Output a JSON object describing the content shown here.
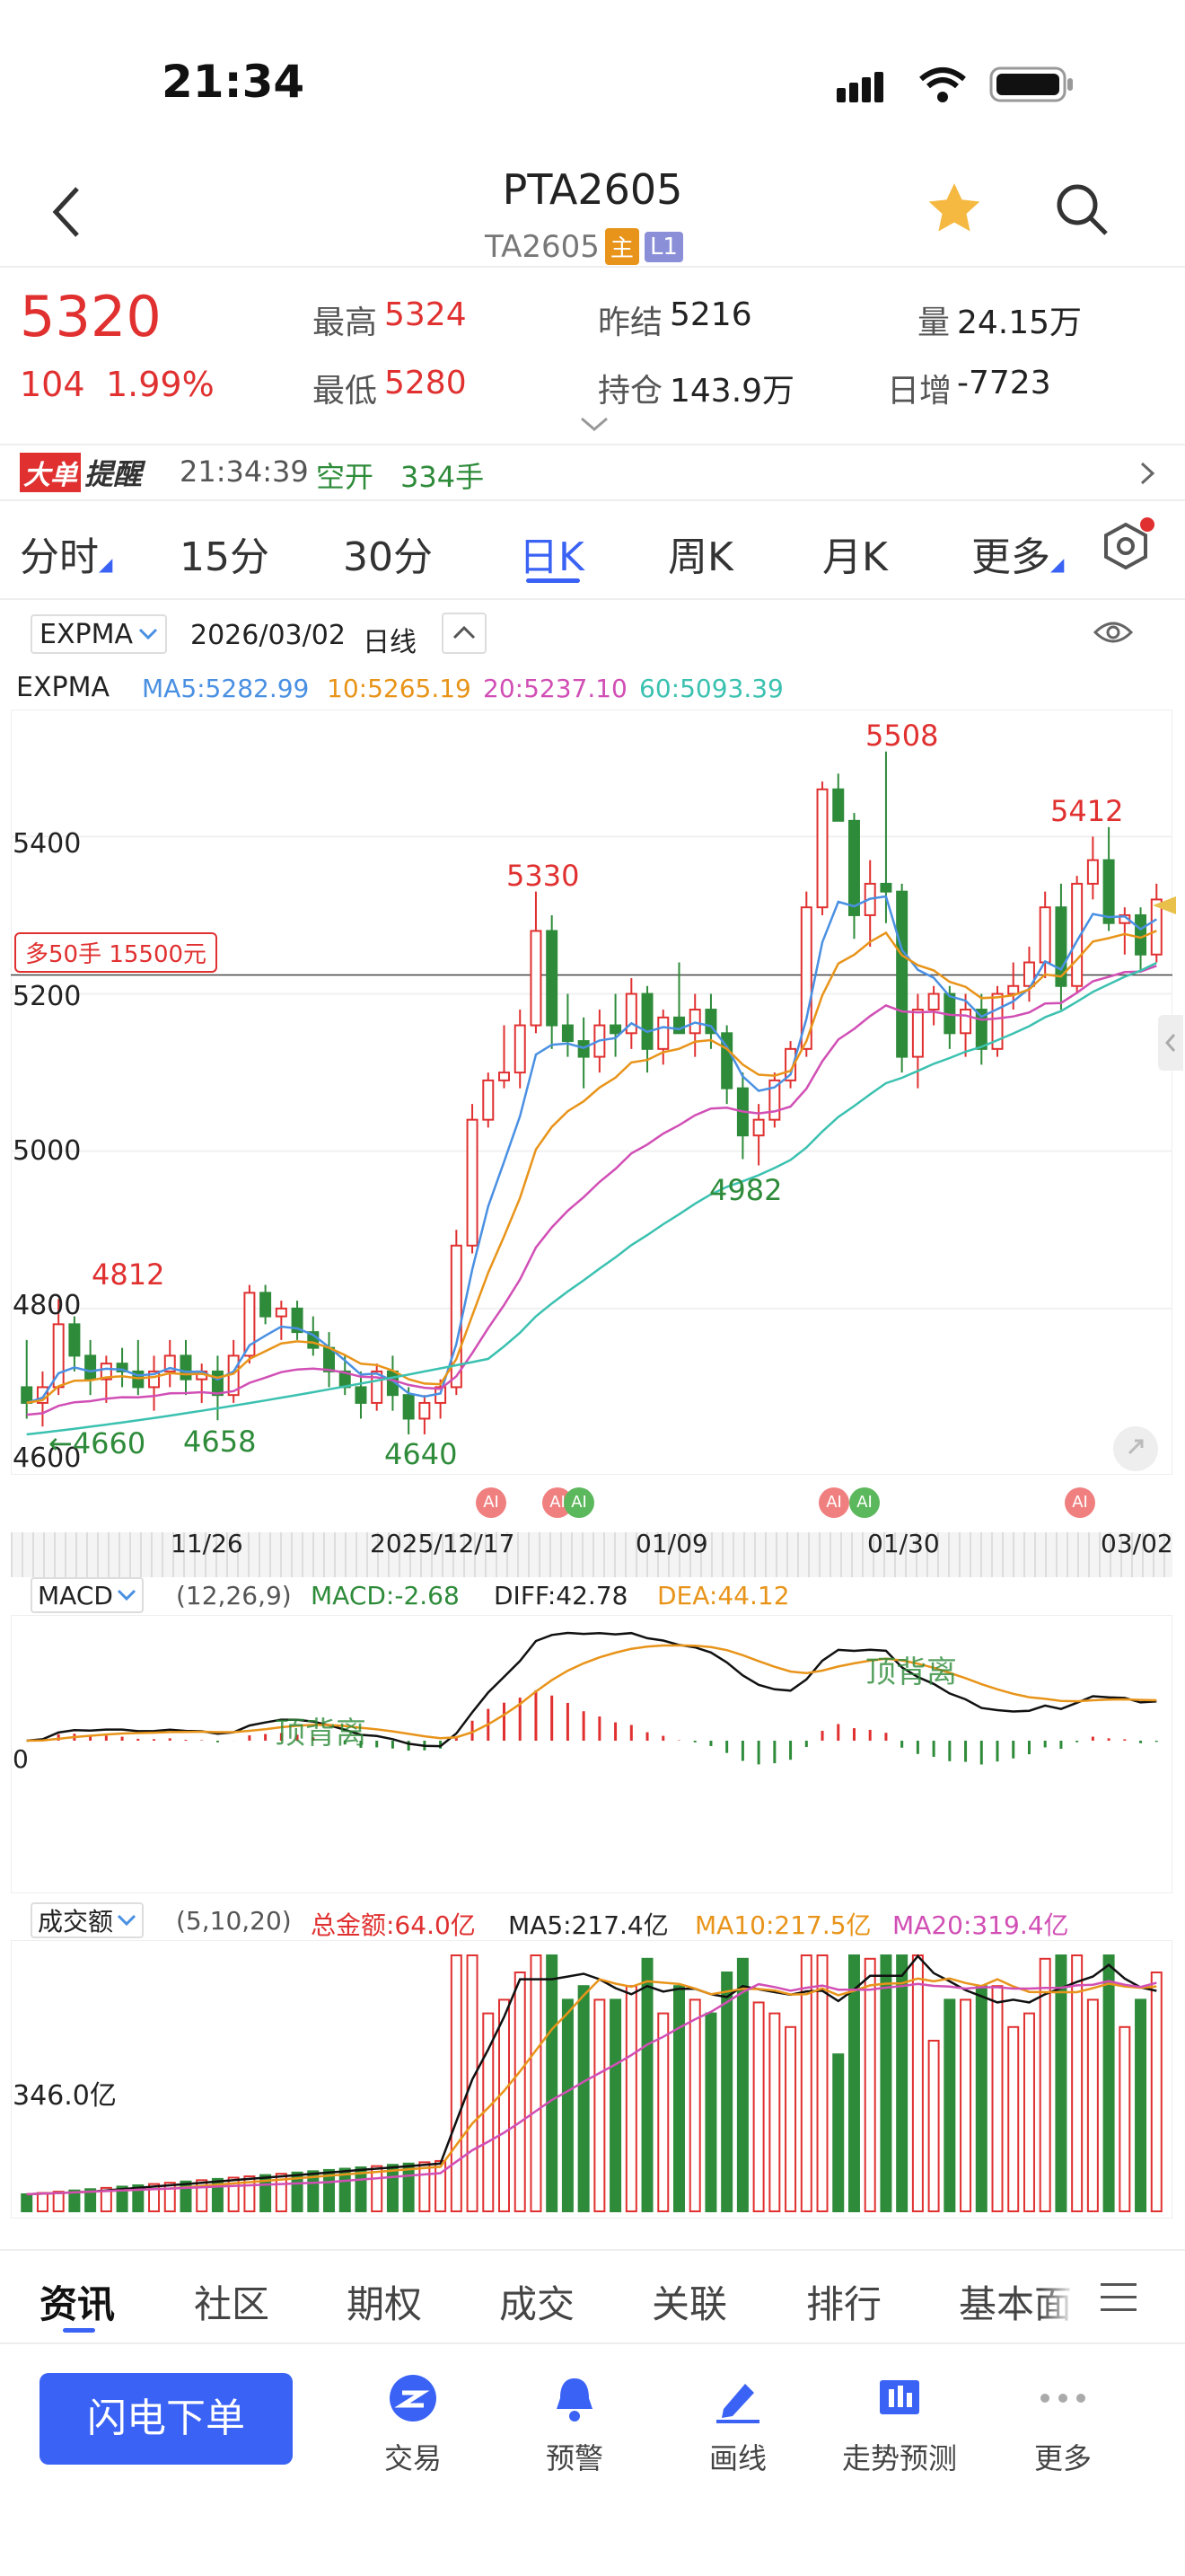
{
  "status_bar": {
    "time": "21:34"
  },
  "header": {
    "title": "PTA2605",
    "subtitle": "TA2605",
    "badge_main": "主",
    "badge_l1": "L1"
  },
  "quote": {
    "last": "5320",
    "change": "104",
    "change_pct": "1.99%",
    "high_label": "最高",
    "high": "5324",
    "low_label": "最低",
    "low": "5280",
    "prev_settle_label": "昨结",
    "prev_settle": "5216",
    "open_interest_label": "持仓",
    "open_interest": "143.9万",
    "volume_label": "量",
    "volume": "24.15万",
    "daily_increase_label": "日增",
    "daily_increase": "-7723"
  },
  "alert": {
    "tag_a": "大单",
    "tag_b": "提醒",
    "time": "21:34:39",
    "type": "空开",
    "qty": "334手"
  },
  "tabs": [
    "分时",
    "15分",
    "30分",
    "日K",
    "周K",
    "月K",
    "更多"
  ],
  "active_tab": "日K",
  "chart_toolbar": {
    "indicator": "EXPMA",
    "date": "2026/03/02",
    "period": "日线"
  },
  "expma": {
    "name": "EXPMA",
    "ma5": "MA5:5282.99",
    "ma10": "10:5265.19",
    "ma20": "20:5237.10",
    "ma60": "60:5093.39"
  },
  "colors": {
    "up": "#e03030",
    "down": "#2e8b3a",
    "ma5": "#4a90e2",
    "ma10": "#e8941a",
    "ma20": "#d14fb5",
    "ma60": "#3bc1b0",
    "accent": "#3a63f5"
  },
  "price_axis": {
    "labels": [
      "5400",
      "5200",
      "5000",
      "4800",
      "4600"
    ]
  },
  "position_tag": "多50手 15500元",
  "annotations": {
    "high_5508": "5508",
    "high_5412": "5412",
    "high_5330": "5330",
    "high_4812": "4812",
    "low_4982": "4982",
    "low_4660": "4660",
    "low_4658": "4658",
    "low_4640": "4640"
  },
  "date_axis": [
    "11/26",
    "2025/12/17",
    "01/09",
    "01/30",
    "03/02"
  ],
  "ai_badge": "AI",
  "macd": {
    "name": "MACD",
    "params": "(12,26,9)",
    "macd": "MACD:-2.68",
    "diff": "DIFF:42.78",
    "dea": "DEA:44.12",
    "zero": "0",
    "note1": "顶背离",
    "note2": "顶背离"
  },
  "turnover": {
    "name": "成交额",
    "params": "(5,10,20)",
    "total": "总金额:64.0亿",
    "ma5": "MA5:217.4亿",
    "ma10": "MA10:217.5亿",
    "ma20": "MA20:319.4亿",
    "axis": "346.0亿"
  },
  "bottom_tabs": [
    "资讯",
    "社区",
    "期权",
    "成交",
    "关联",
    "排行",
    "基本面"
  ],
  "toolbar": {
    "primary": "闪电下单",
    "items": [
      "交易",
      "预警",
      "画线",
      "走势预测",
      "更多"
    ]
  },
  "chart_data": {
    "type": "candlestick",
    "title": "PTA2605 日线",
    "ylim": [
      4600,
      5550
    ],
    "x_labels": [
      "11/26",
      "2025/12/17",
      "01/09",
      "01/30",
      "03/02"
    ],
    "candles": [
      [
        4700,
        4760,
        4660,
        4680
      ],
      [
        4680,
        4720,
        4650,
        4700
      ],
      [
        4700,
        4812,
        4690,
        4780
      ],
      [
        4780,
        4790,
        4720,
        4740
      ],
      [
        4740,
        4760,
        4690,
        4710
      ],
      [
        4710,
        4740,
        4680,
        4730
      ],
      [
        4730,
        4750,
        4700,
        4720
      ],
      [
        4720,
        4760,
        4690,
        4700
      ],
      [
        4700,
        4740,
        4670,
        4720
      ],
      [
        4720,
        4760,
        4700,
        4740
      ],
      [
        4740,
        4760,
        4690,
        4710
      ],
      [
        4710,
        4730,
        4680,
        4720
      ],
      [
        4720,
        4740,
        4658,
        4690
      ],
      [
        4690,
        4760,
        4680,
        4740
      ],
      [
        4740,
        4830,
        4730,
        4820
      ],
      [
        4820,
        4830,
        4780,
        4790
      ],
      [
        4790,
        4810,
        4760,
        4800
      ],
      [
        4800,
        4810,
        4760,
        4770
      ],
      [
        4770,
        4790,
        4740,
        4750
      ],
      [
        4750,
        4770,
        4700,
        4720
      ],
      [
        4720,
        4740,
        4690,
        4700
      ],
      [
        4700,
        4720,
        4660,
        4680
      ],
      [
        4680,
        4730,
        4670,
        4720
      ],
      [
        4720,
        4740,
        4670,
        4690
      ],
      [
        4690,
        4700,
        4640,
        4660
      ],
      [
        4660,
        4690,
        4640,
        4680
      ],
      [
        4680,
        4710,
        4660,
        4700
      ],
      [
        4700,
        4900,
        4690,
        4880
      ],
      [
        4880,
        5060,
        4870,
        5040
      ],
      [
        5040,
        5100,
        5030,
        5090
      ],
      [
        5090,
        5160,
        5080,
        5100
      ],
      [
        5100,
        5180,
        5080,
        5160
      ],
      [
        5160,
        5330,
        5150,
        5280
      ],
      [
        5280,
        5300,
        5130,
        5160
      ],
      [
        5160,
        5200,
        5120,
        5140
      ],
      [
        5140,
        5170,
        5080,
        5120
      ],
      [
        5120,
        5180,
        5100,
        5160
      ],
      [
        5160,
        5200,
        5120,
        5150
      ],
      [
        5150,
        5220,
        5130,
        5200
      ],
      [
        5200,
        5210,
        5100,
        5130
      ],
      [
        5130,
        5180,
        5110,
        5170
      ],
      [
        5170,
        5240,
        5150,
        5150
      ],
      [
        5150,
        5200,
        5120,
        5180
      ],
      [
        5180,
        5200,
        5130,
        5150
      ],
      [
        5150,
        5160,
        5060,
        5080
      ],
      [
        5080,
        5100,
        4990,
        5020
      ],
      [
        5020,
        5060,
        4982,
        5040
      ],
      [
        5040,
        5100,
        5030,
        5090
      ],
      [
        5090,
        5140,
        5080,
        5130
      ],
      [
        5130,
        5330,
        5120,
        5310
      ],
      [
        5310,
        5470,
        5300,
        5460
      ],
      [
        5460,
        5480,
        5440,
        5420
      ],
      [
        5420,
        5430,
        5270,
        5300
      ],
      [
        5300,
        5370,
        5260,
        5340
      ],
      [
        5340,
        5508,
        5290,
        5330
      ],
      [
        5330,
        5340,
        5100,
        5120
      ],
      [
        5120,
        5200,
        5080,
        5180
      ],
      [
        5180,
        5210,
        5160,
        5200
      ],
      [
        5200,
        5210,
        5130,
        5150
      ],
      [
        5150,
        5200,
        5120,
        5180
      ],
      [
        5180,
        5200,
        5110,
        5130
      ],
      [
        5130,
        5210,
        5120,
        5200
      ],
      [
        5200,
        5240,
        5180,
        5210
      ],
      [
        5210,
        5260,
        5190,
        5240
      ],
      [
        5240,
        5330,
        5220,
        5310
      ],
      [
        5310,
        5340,
        5180,
        5210
      ],
      [
        5210,
        5350,
        5200,
        5340
      ],
      [
        5340,
        5400,
        5320,
        5370
      ],
      [
        5370,
        5412,
        5280,
        5290
      ],
      [
        5290,
        5310,
        5250,
        5300
      ],
      [
        5300,
        5310,
        5230,
        5250
      ],
      [
        5250,
        5340,
        5240,
        5320
      ]
    ],
    "series": [
      {
        "name": "MA5",
        "color": "#4a90e2"
      },
      {
        "name": "10",
        "color": "#e8941a"
      },
      {
        "name": "20",
        "color": "#d14fb5"
      },
      {
        "name": "60",
        "color": "#3bc1b0"
      }
    ]
  }
}
